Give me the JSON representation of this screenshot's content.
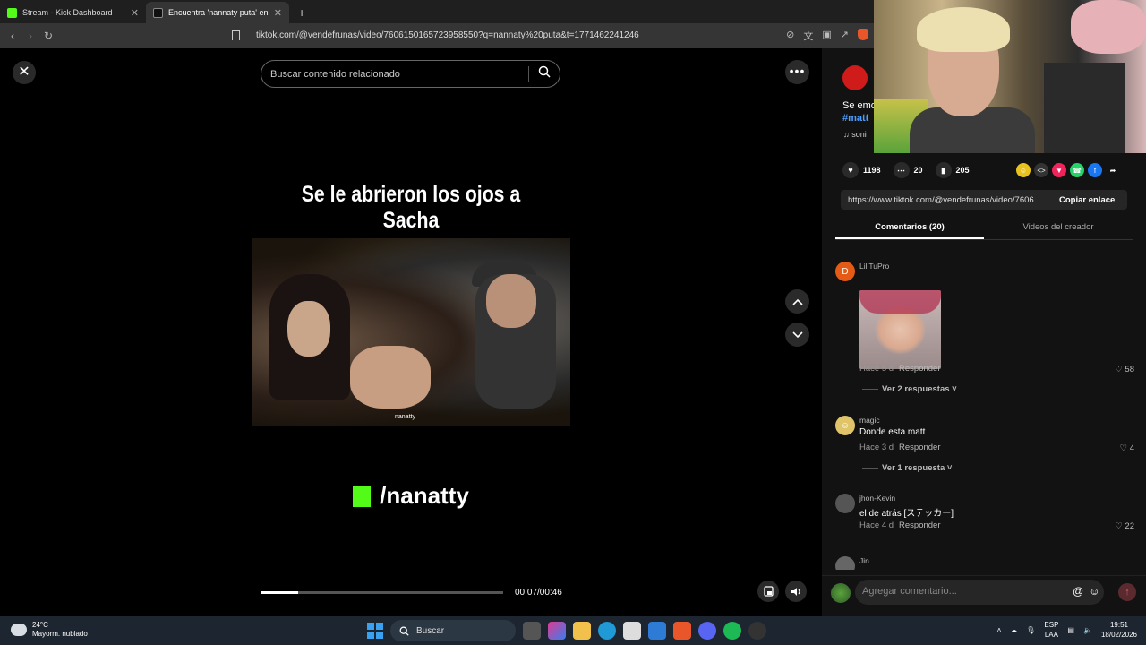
{
  "browser": {
    "tabs": [
      {
        "title": "Stream - Kick Dashboard",
        "active": false
      },
      {
        "title": "Encuentra 'nannaty puta' en T",
        "active": true
      }
    ],
    "new_tab": "+",
    "url": "tiktok.com/@vendefrunas/video/7606150165723958550?q=nannaty%20puta&t=1771462241246"
  },
  "player": {
    "search_placeholder": "Buscar contenido relacionado",
    "caption": "Se le abrieron los ojos a Sacha",
    "kick_handle": "/nanatty",
    "clip_watermark": "nanatty",
    "time": "00:07/00:46",
    "progress": 0.155
  },
  "post": {
    "description": "Se emo",
    "hashtag": "#matt",
    "sound": "soni",
    "likes": "1198",
    "comments": "20",
    "saves": "205",
    "link": "https://www.tiktok.com/@vendefrunas/video/7606...",
    "copy_label": "Copiar enlace"
  },
  "panel_tabs": [
    {
      "label": "Comentarios (20)",
      "active": true
    },
    {
      "label": "Videos del creador",
      "active": false
    }
  ],
  "comments": [
    {
      "user": "LiliTuPro",
      "avatar_letter": "D",
      "text": "",
      "age": "Hace 5 d",
      "reply": "Responder",
      "likes": "58",
      "replies": "Ver 2 respuestas"
    },
    {
      "user": "magic",
      "avatar_letter": "",
      "text": "Donde esta matt",
      "age": "Hace 3 d",
      "reply": "Responder",
      "likes": "4",
      "replies": "Ver 1 respuesta"
    },
    {
      "user": "jhon-Kevin",
      "avatar_letter": "",
      "text": "el de atrás [ステッカー]",
      "age": "Hace 4 d",
      "reply": "Responder",
      "likes": "22",
      "replies": ""
    },
    {
      "user": "Jin",
      "avatar_letter": "",
      "text": "",
      "age": "",
      "reply": "",
      "likes": "",
      "replies": ""
    }
  ],
  "composer": {
    "placeholder": "Agregar comentario..."
  },
  "taskbar": {
    "temp": "24°C",
    "weather": "Mayorm. nublado",
    "search": "Buscar",
    "lang1": "ESP",
    "lang2": "LAA",
    "time": "19:51",
    "date": "18/02/2026"
  },
  "colors": {
    "kick_green": "#53fc18",
    "tiktok_link": "#4ea0ff"
  }
}
